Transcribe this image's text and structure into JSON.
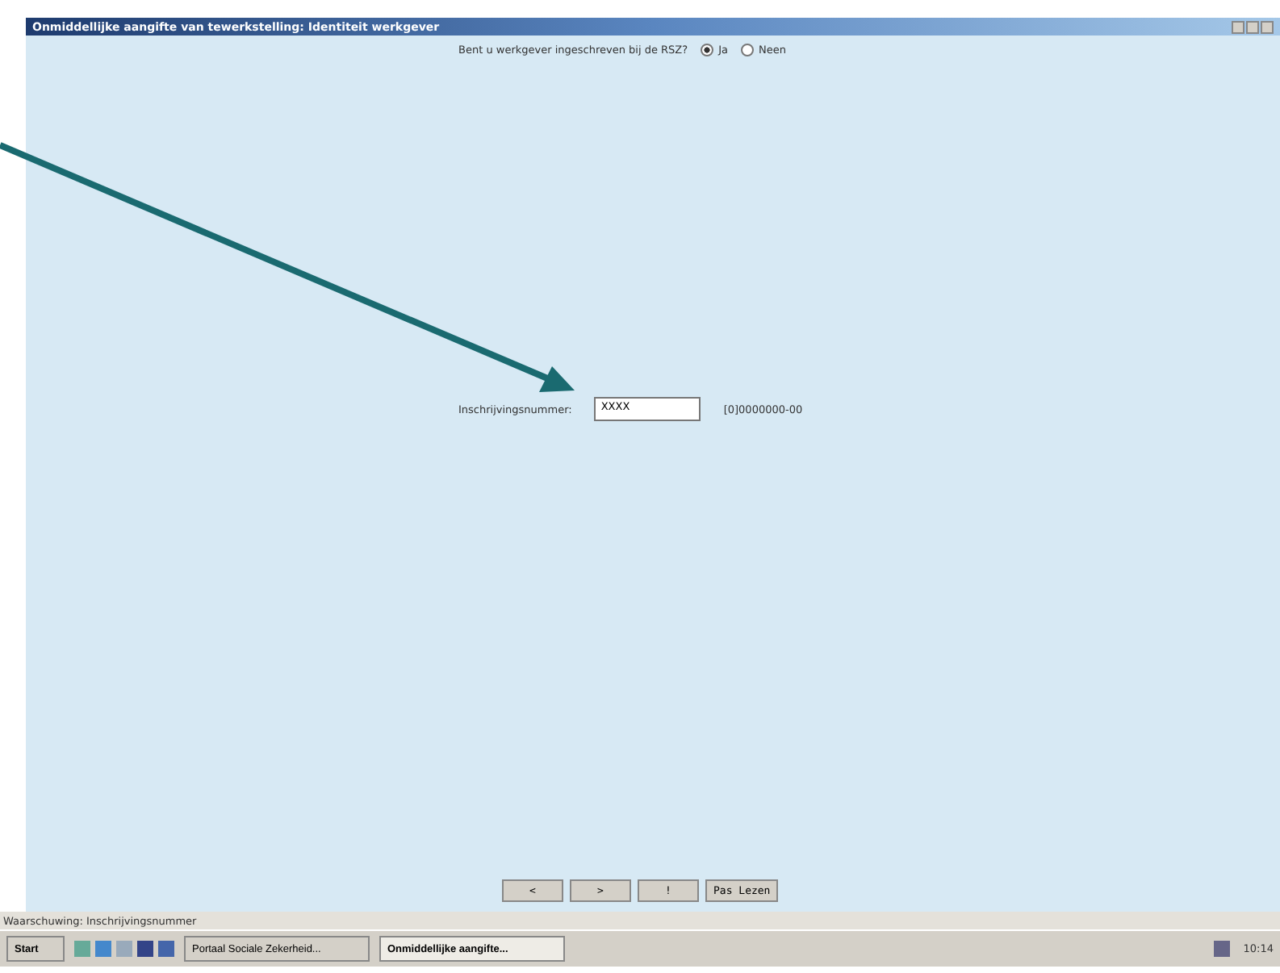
{
  "window": {
    "title": "Onmiddellijke aangifte van tewerkstelling: Identiteit werkgever"
  },
  "question": {
    "label": "Bent u werkgever ingeschreven bij de RSZ?",
    "options": [
      {
        "label": "Ja",
        "selected": true
      },
      {
        "label": "Neen",
        "selected": false
      }
    ]
  },
  "field": {
    "label": "Inschrijvingsnummer:",
    "value": "XXXX",
    "hint": "[0]0000000-00"
  },
  "nav_buttons": [
    "<",
    ">",
    "!",
    "Pas Lezen"
  ],
  "status_bar": "Waarschuwing: Inschrijvingsnummer",
  "taskbar": {
    "start": "Start",
    "tasks": [
      {
        "label": "Portaal Sociale Zekerheid...",
        "selected": false
      },
      {
        "label": "Onmiddellijke aangifte...",
        "selected": true
      }
    ],
    "clock": "10:14"
  }
}
